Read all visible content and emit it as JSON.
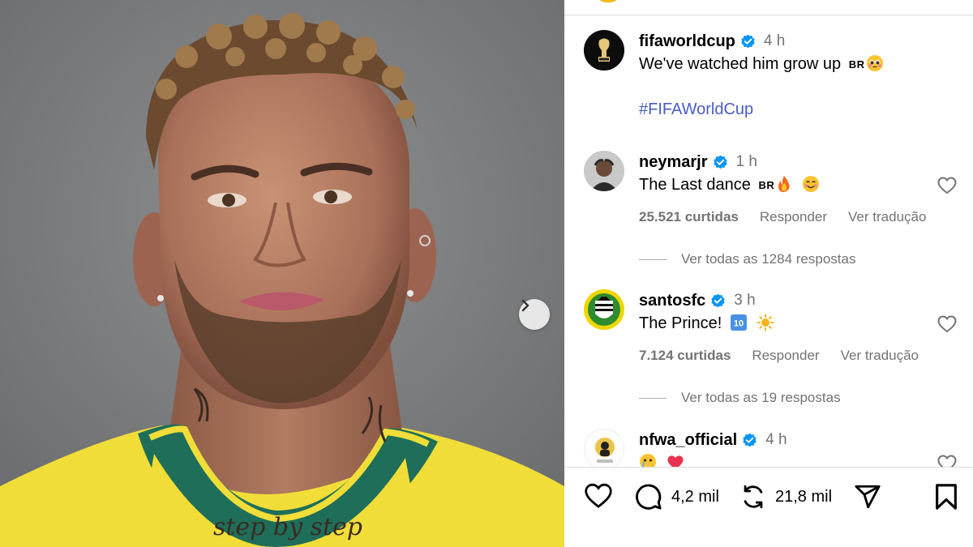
{
  "post": {
    "author": "fifaworldcup",
    "time": "4 h",
    "caption": "We've watched him grow up",
    "caption_flag": "BR",
    "hashtag": "#FIFAWorldCup",
    "image_tattoo_text": "step by step"
  },
  "comments": [
    {
      "user": "neymarjr",
      "time": "1 h",
      "text": "The Last dance",
      "flag": "BR",
      "likes": "25.521 curtidas",
      "reply_label": "Responder",
      "translate_label": "Ver tradução",
      "view_replies": "Ver todas as 1284 respostas"
    },
    {
      "user": "santosfc",
      "time": "3 h",
      "text": "The Prince!",
      "likes": "7.124 curtidas",
      "reply_label": "Responder",
      "translate_label": "Ver tradução",
      "view_replies": "Ver todas as 19 respostas"
    },
    {
      "user": "nfwa_official",
      "time": "4 h"
    }
  ],
  "actions": {
    "comments_count": "4,2 mil",
    "reposts_count": "21,8 mil"
  },
  "colors": {
    "verified": "#0095f6",
    "hashtag": "#4a5cc5",
    "muted": "#737373",
    "photo_bg": "#7d7e80",
    "jersey": "#f3e23b",
    "collar": "#1e6e5a"
  },
  "icons": [
    "chevron-right-icon",
    "verified-badge-icon",
    "heart-icon",
    "comment-icon",
    "repost-icon",
    "share-icon",
    "bookmark-icon",
    "fire-emoji-icon",
    "smile-emoji-icon",
    "pleading-emoji-icon",
    "keycap-ten-icon",
    "sun-emoji-icon"
  ]
}
